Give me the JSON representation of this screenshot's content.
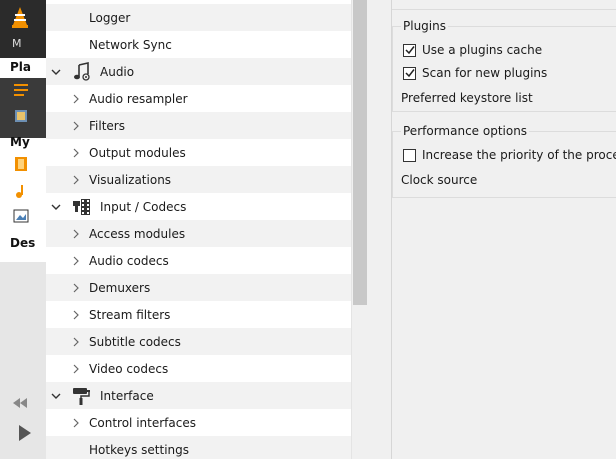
{
  "background_window": {
    "labels": [
      "M",
      "Pla",
      "My",
      "Des"
    ]
  },
  "tree": {
    "items": [
      {
        "label": "Logger",
        "expander": "none",
        "icon": ""
      },
      {
        "label": "Network Sync",
        "expander": "none",
        "icon": ""
      },
      {
        "label": "Audio",
        "expander": "expanded",
        "icon": "music-note-icon"
      },
      {
        "label": "Audio resampler",
        "expander": "collapsed",
        "icon": ""
      },
      {
        "label": "Filters",
        "expander": "collapsed",
        "icon": ""
      },
      {
        "label": "Output modules",
        "expander": "collapsed",
        "icon": ""
      },
      {
        "label": "Visualizations",
        "expander": "collapsed",
        "icon": ""
      },
      {
        "label": "Input / Codecs",
        "expander": "expanded",
        "icon": "input-codecs-icon"
      },
      {
        "label": "Access modules",
        "expander": "collapsed",
        "icon": ""
      },
      {
        "label": "Audio codecs",
        "expander": "collapsed",
        "icon": ""
      },
      {
        "label": "Demuxers",
        "expander": "collapsed",
        "icon": ""
      },
      {
        "label": "Stream filters",
        "expander": "collapsed",
        "icon": ""
      },
      {
        "label": "Subtitle codecs",
        "expander": "collapsed",
        "icon": ""
      },
      {
        "label": "Video codecs",
        "expander": "collapsed",
        "icon": ""
      },
      {
        "label": "Interface",
        "expander": "expanded",
        "icon": "paint-roller-icon"
      },
      {
        "label": "Control interfaces",
        "expander": "collapsed",
        "icon": ""
      },
      {
        "label": "Hotkeys settings",
        "expander": "none",
        "icon": ""
      }
    ]
  },
  "plugins_group": {
    "title": "Plugins",
    "use_cache": {
      "label": "Use a plugins cache",
      "checked": true
    },
    "scan_new": {
      "label": "Scan for new plugins",
      "checked": true
    },
    "keystore": {
      "label": "Preferred keystore list"
    }
  },
  "performance_group": {
    "title": "Performance options",
    "increase_priority": {
      "label": "Increase the priority of the process",
      "checked": false
    },
    "clock_source": {
      "label": "Clock source"
    }
  }
}
